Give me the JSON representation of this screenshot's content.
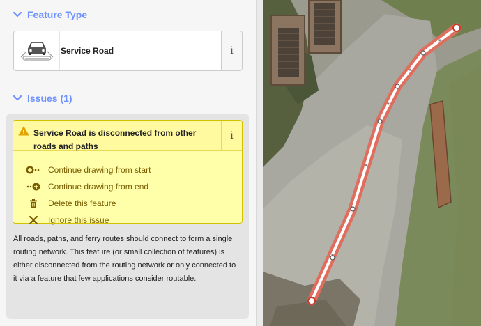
{
  "feature_type": {
    "heading": "Feature Type",
    "preset_name": "Service Road",
    "info_glyph": "i",
    "icon": "car-road-icon"
  },
  "issues": {
    "heading": "Issues (1)",
    "warning": {
      "message": "Service Road is disconnected from other roads and paths",
      "info_glyph": "i"
    },
    "fixes": [
      {
        "label": "Continue drawing from start",
        "icon": "continue-from-start-icon"
      },
      {
        "label": "Continue drawing from end",
        "icon": "continue-from-end-icon"
      },
      {
        "label": "Delete this feature",
        "icon": "trash-icon"
      },
      {
        "label": "Ignore this issue",
        "icon": "close-icon"
      }
    ],
    "description": "All roads, paths, and ferry routes should connect to form a single routing network. This feature (or small collection of features) is either disconnected from the routing network or only connected to it via a feature that few applications consider routable."
  },
  "colors": {
    "accent": "#7092ff",
    "warning_bg": "#ffffaa",
    "fix_text": "#7a5d00",
    "selected_line": "#e06e5f"
  }
}
